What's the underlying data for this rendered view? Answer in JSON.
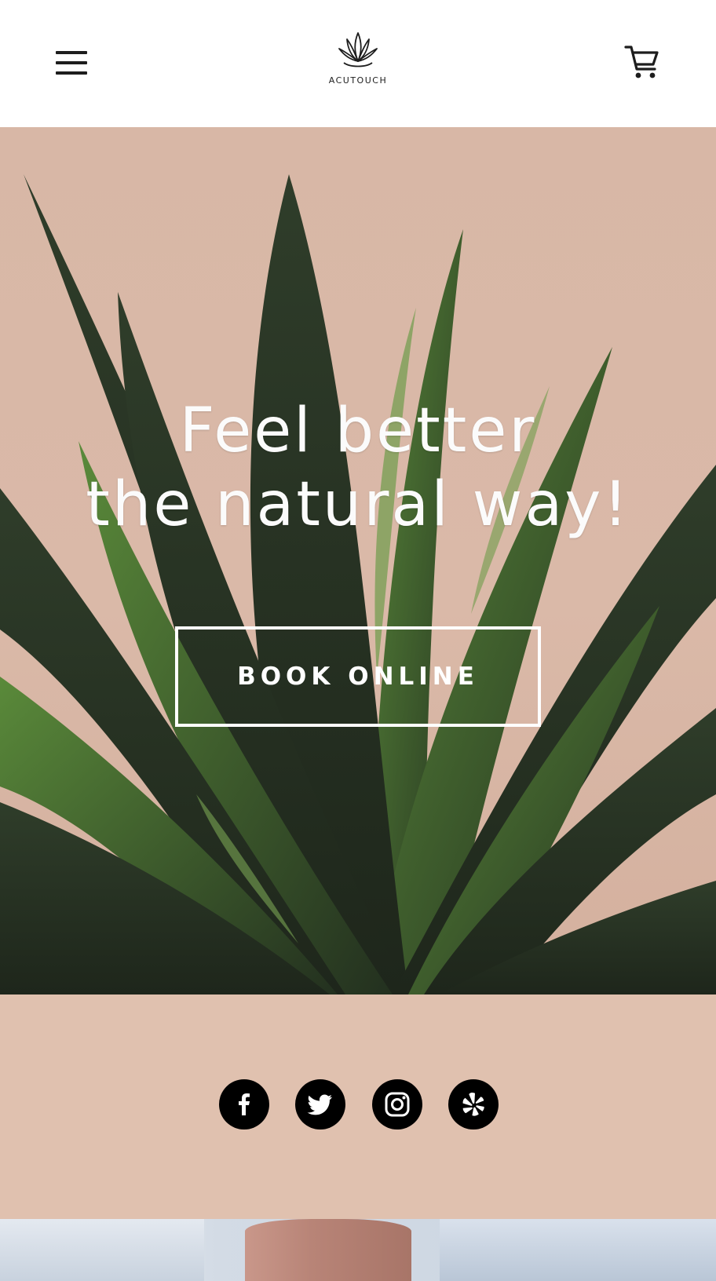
{
  "header": {
    "menu_icon": "hamburger-menu-icon",
    "logo_text": "ACUTOUCH",
    "logo_icon": "lotus-leaf-icon",
    "cart_icon": "shopping-cart-icon"
  },
  "hero": {
    "title_line1": "Feel better",
    "title_line2": "the natural way!",
    "button_label": "BOOK ONLINE"
  },
  "social": {
    "items": [
      {
        "icon": "facebook-icon"
      },
      {
        "icon": "twitter-icon"
      },
      {
        "icon": "instagram-icon"
      },
      {
        "icon": "yelp-icon"
      }
    ]
  },
  "colors": {
    "hero_bg": "#d8b7a6",
    "social_bg": "#e0c1af",
    "plant_dark": "#2a3326",
    "plant_light": "#4f7a36",
    "text_dark": "#1d1d1d",
    "white": "#ffffff"
  }
}
